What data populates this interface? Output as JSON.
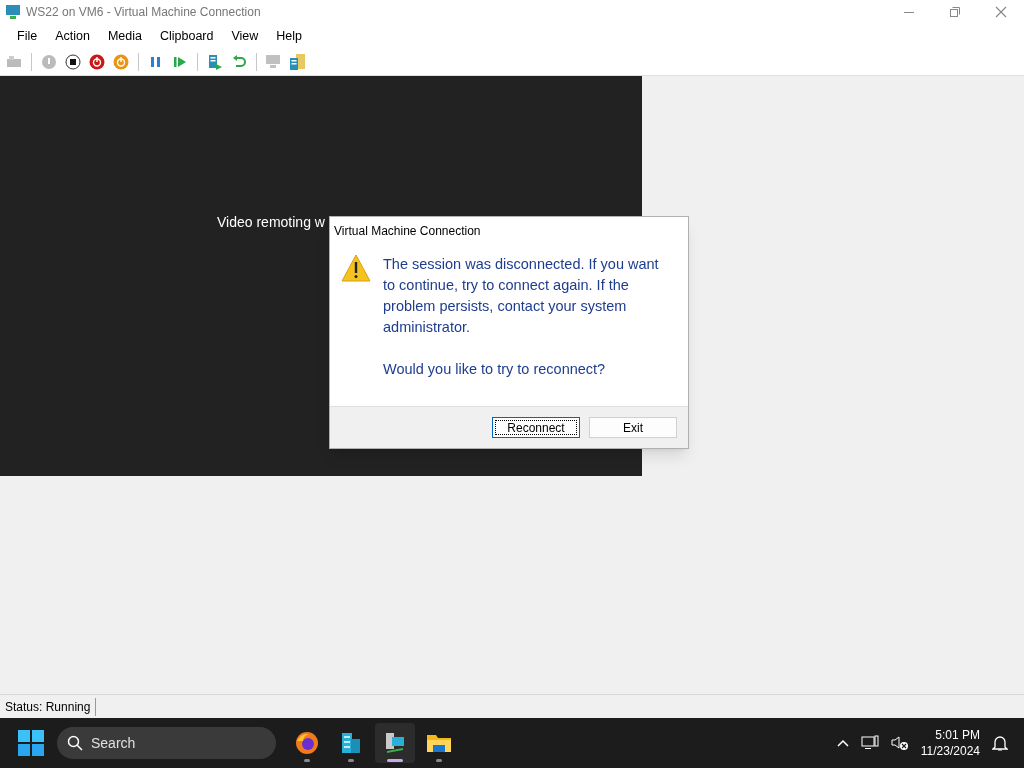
{
  "window": {
    "title": "WS22 on VM6 - Virtual Machine Connection"
  },
  "menu": [
    "File",
    "Action",
    "Media",
    "Clipboard",
    "View",
    "Help"
  ],
  "toolbar": [
    {
      "kind": "keyboard",
      "disabled": true
    },
    {
      "kind": "sep"
    },
    {
      "kind": "start",
      "disabled": true
    },
    {
      "kind": "turnoff",
      "disabled": false
    },
    {
      "kind": "shutdown",
      "disabled": false
    },
    {
      "kind": "save",
      "disabled": false
    },
    {
      "kind": "sep"
    },
    {
      "kind": "pause",
      "disabled": false
    },
    {
      "kind": "resume",
      "disabled": false
    },
    {
      "kind": "sep"
    },
    {
      "kind": "checkpoint",
      "disabled": false
    },
    {
      "kind": "revert",
      "disabled": false
    },
    {
      "kind": "sep"
    },
    {
      "kind": "enhanced",
      "disabled": true
    },
    {
      "kind": "zoom",
      "disabled": false
    }
  ],
  "vm_screen": {
    "message": "Video remoting w"
  },
  "dialog": {
    "title": "Virtual Machine Connection",
    "message": "The session was disconnected. If you want to continue, try to connect again. If the problem persists, contact your system administrator.",
    "question": "Would you like to try to reconnect?",
    "buttons": [
      {
        "label": "Reconnect",
        "focused": true
      },
      {
        "label": "Exit",
        "focused": false
      }
    ]
  },
  "status_bar": {
    "text": "Status: Running"
  },
  "taskbar": {
    "search": {
      "placeholder": "Search"
    },
    "apps": [
      {
        "kind": "firefox",
        "active": false
      },
      {
        "kind": "server",
        "active": false
      },
      {
        "kind": "vmconnect",
        "active": true
      },
      {
        "kind": "folder",
        "active": false
      }
    ],
    "time": "5:01 PM",
    "date": "11/23/2024"
  }
}
